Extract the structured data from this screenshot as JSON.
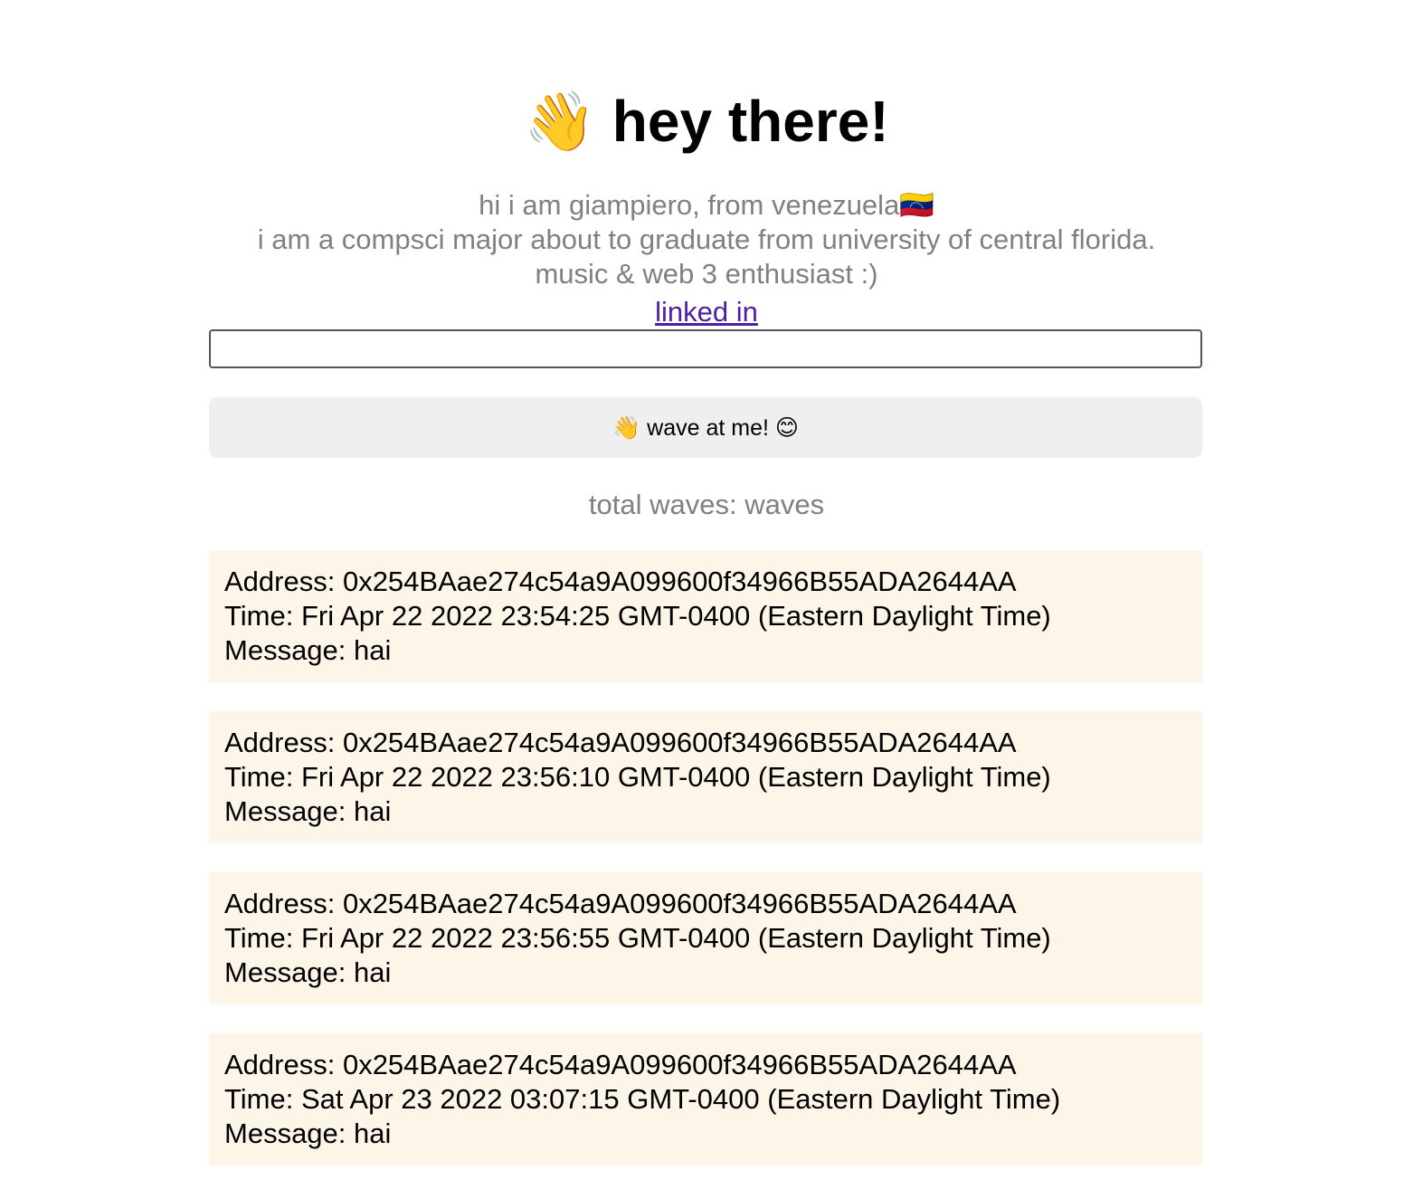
{
  "header": {
    "emoji": "👋",
    "title": "hey there!"
  },
  "bio": {
    "line1": "hi i am giampiero, from venezuela🇻🇪",
    "line2": "i am a compsci major about to graduate from university of central florida.",
    "line3": "music & web 3 enthusiast :)",
    "link_label": "linked in"
  },
  "message_input": {
    "value": "",
    "placeholder": ""
  },
  "wave_button": {
    "label": "👋 wave at me! 😊"
  },
  "stats": {
    "total_label": "total waves: waves"
  },
  "waves": [
    {
      "address": "Address: 0x254BAae274c54a9A099600f34966B55ADA2644AA",
      "time": "Time: Fri Apr 22 2022 23:54:25 GMT-0400 (Eastern Daylight Time)",
      "message": "Message: hai"
    },
    {
      "address": "Address: 0x254BAae274c54a9A099600f34966B55ADA2644AA",
      "time": "Time: Fri Apr 22 2022 23:56:10 GMT-0400 (Eastern Daylight Time)",
      "message": "Message: hai"
    },
    {
      "address": "Address: 0x254BAae274c54a9A099600f34966B55ADA2644AA",
      "time": "Time: Fri Apr 22 2022 23:56:55 GMT-0400 (Eastern Daylight Time)",
      "message": "Message: hai"
    },
    {
      "address": "Address: 0x254BAae274c54a9A099600f34966B55ADA2644AA",
      "time": "Time: Sat Apr 23 2022 03:07:15 GMT-0400 (Eastern Daylight Time)",
      "message": "Message: hai"
    }
  ],
  "colors": {
    "card_background": "#fdf5e8",
    "button_background": "#efefef",
    "muted_text": "#808080",
    "link": "#4b1fa8"
  }
}
